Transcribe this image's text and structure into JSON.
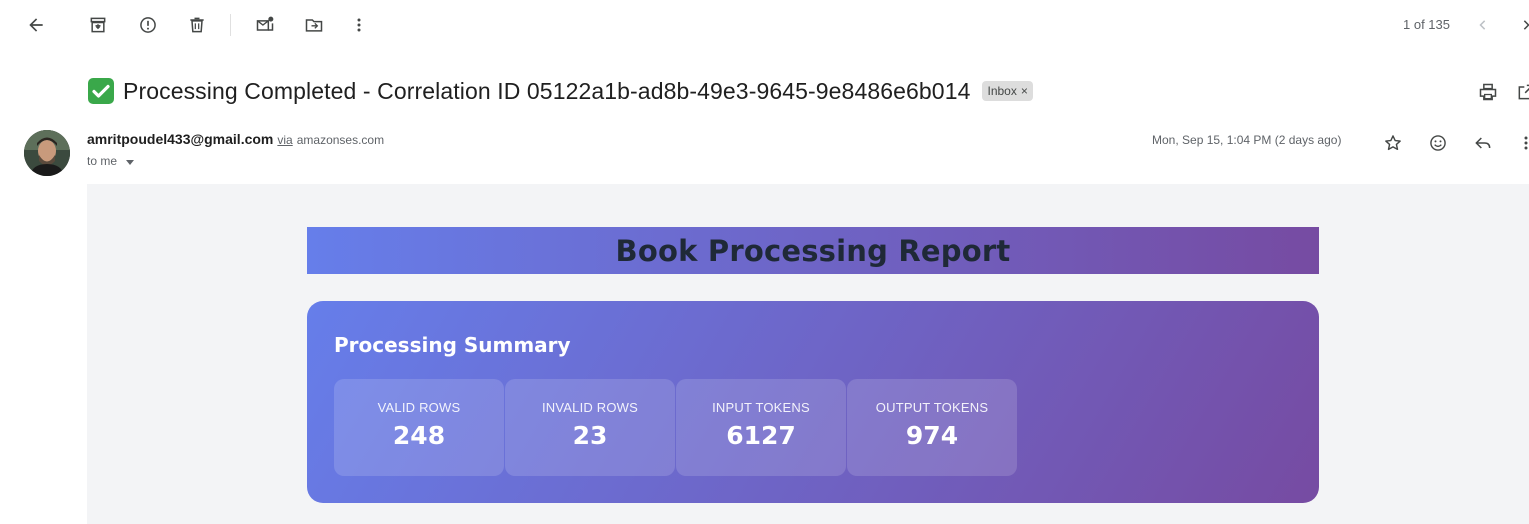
{
  "toolbar": {
    "back_icon": "arrow-left-icon",
    "archive_icon": "archive-icon",
    "spam_icon": "report-spam-icon",
    "delete_icon": "trash-icon",
    "mark_unread_icon": "mark-unread-icon",
    "move_icon": "move-to-icon",
    "more_icon": "more-vertical-icon",
    "pager_text": "1 of 135",
    "prev_icon": "chevron-left-icon",
    "next_icon": "chevron-right-icon"
  },
  "subject": {
    "emoji": "✅",
    "text": "Processing Completed - Correlation ID 05122a1b-ad8b-49e3-9645-9e8486e6b014",
    "label_chip": "Inbox",
    "label_remove": "×"
  },
  "sender": {
    "email": "amritpoudel433@gmail.com",
    "via_label": "via",
    "via_domain": "amazonses.com",
    "to_text": "to me",
    "date": "Mon, Sep 15, 1:04 PM (2 days ago)"
  },
  "report": {
    "title": "Book Processing Report",
    "summary_title": "Processing Summary",
    "stats": [
      {
        "label": "VALID ROWS",
        "value": "248"
      },
      {
        "label": "INVALID ROWS",
        "value": "23"
      },
      {
        "label": "INPUT TOKENS",
        "value": "6127"
      },
      {
        "label": "OUTPUT TOKENS",
        "value": "974"
      }
    ]
  },
  "colors": {
    "gradient_start": "#667eea",
    "gradient_end": "#764ba2",
    "body_background": "#f3f4f6"
  }
}
